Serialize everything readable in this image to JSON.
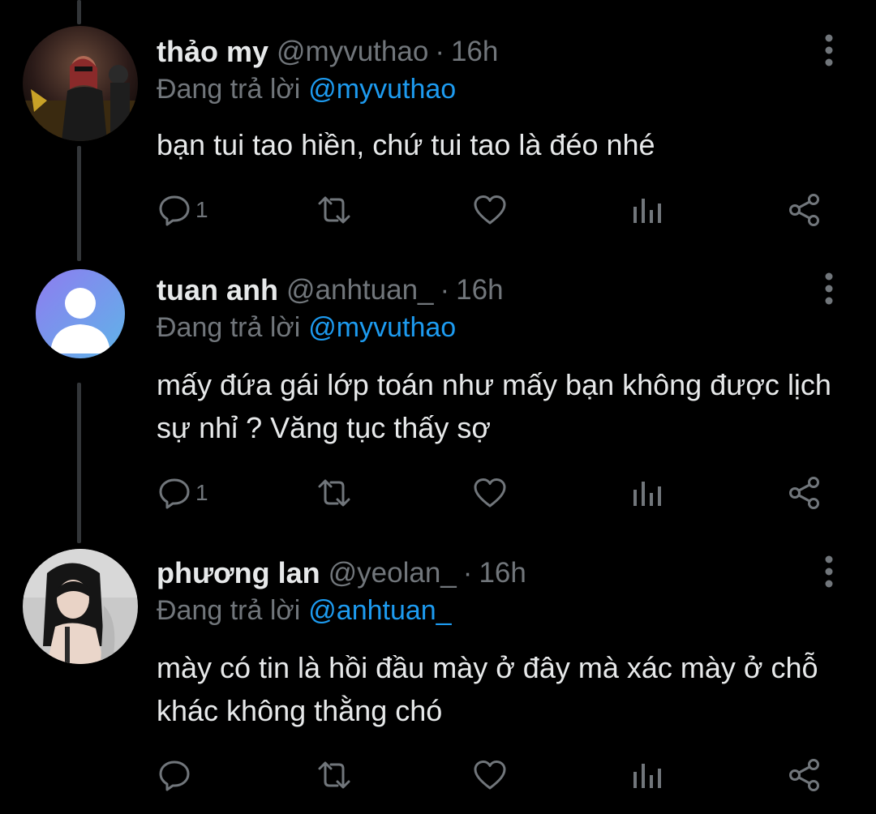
{
  "colors": {
    "background": "#000000",
    "primary_text": "#e7e9ea",
    "secondary_text": "#71767b",
    "mention": "#1d9bf0",
    "thread_line": "#333639"
  },
  "tweets": [
    {
      "display_name": "thảo my",
      "handle": "@myvuthao",
      "separator": "·",
      "time": "16h",
      "reply_prefix": "Đang trả lời",
      "reply_to": "@myvuthao",
      "text": "bạn tui tao hiền, chứ tui tao là đéo nhé",
      "reply_count": "1",
      "avatar": "photo"
    },
    {
      "display_name": "tuan anh",
      "handle": "@anhtuan_",
      "separator": "·",
      "time": "16h",
      "reply_prefix": "Đang trả lời",
      "reply_to": "@myvuthao",
      "text": "mấy đứa gái lớp toán như mấy bạn không được lịch sự nhỉ ? Văng tục thấy sợ",
      "reply_count": "1",
      "avatar": "default-profile"
    },
    {
      "display_name": "phương lan",
      "handle": "@yeolan_",
      "separator": "·",
      "time": "16h",
      "reply_prefix": "Đang trả lời",
      "reply_to": "@anhtuan_",
      "text": "mày có tin là hồi đầu mày ở đây mà xác mày ở chỗ khác không thằng chó",
      "reply_count": "",
      "avatar": "photo"
    }
  ],
  "icons": {
    "reply": "comment-bubble-icon",
    "retweet": "retweet-icon",
    "like": "heart-icon",
    "analytics": "analytics-bars-icon",
    "share": "share-icon",
    "more": "more-vertical-icon"
  }
}
